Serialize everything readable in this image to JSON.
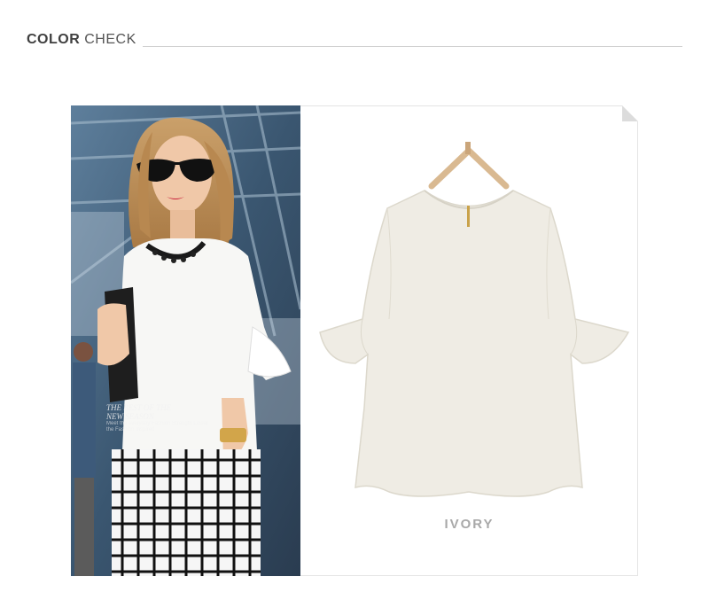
{
  "header": {
    "title_bold": "COLOR",
    "title_light": "CHECK"
  },
  "photo": {
    "caption_line1": "THE BEST OF THE",
    "caption_line2": "NEW SEASON",
    "small_text": "Meet the everyday Fashion Strength Lower the Fashion Inspired"
  },
  "product": {
    "color_name": "IVORY",
    "garment_color": "#efece4"
  }
}
